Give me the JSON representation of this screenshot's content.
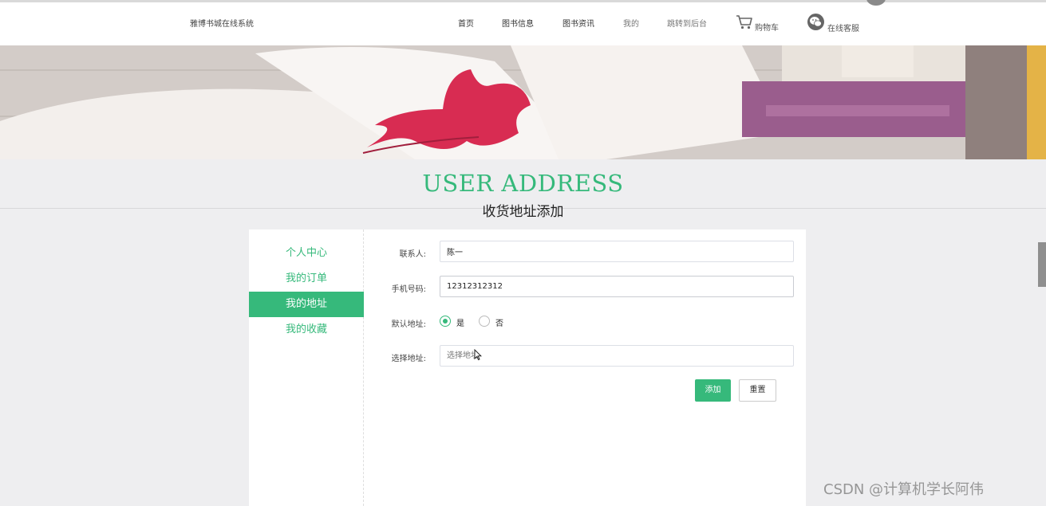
{
  "header": {
    "site_title": "雅博书城在线系统",
    "nav": {
      "home": "首页",
      "books": "图书信息",
      "news": "图书资讯",
      "mine": "我的",
      "admin": "跳转到后台",
      "cart": "购物车",
      "service": "在线客服"
    }
  },
  "page": {
    "title_en": "USER ADDRESS",
    "title_cn": "收货地址添加"
  },
  "sidebar": {
    "items": [
      "个人中心",
      "我的订单",
      "我的地址",
      "我的收藏"
    ],
    "active": "我的地址"
  },
  "form": {
    "contact_label": "联系人:",
    "contact_value": "陈一",
    "phone_label": "手机号码:",
    "phone_value": "12312312312",
    "default_label": "默认地址:",
    "default_options": [
      "是",
      "否"
    ],
    "default_selected": "是",
    "address_label": "选择地址:",
    "address_placeholder": "选择地址"
  },
  "buttons": {
    "add": "添加",
    "reset": "重置"
  },
  "watermark": "CSDN @计算机学长阿伟",
  "colors": {
    "accent": "#36b97b",
    "background": "#eeeef0"
  }
}
